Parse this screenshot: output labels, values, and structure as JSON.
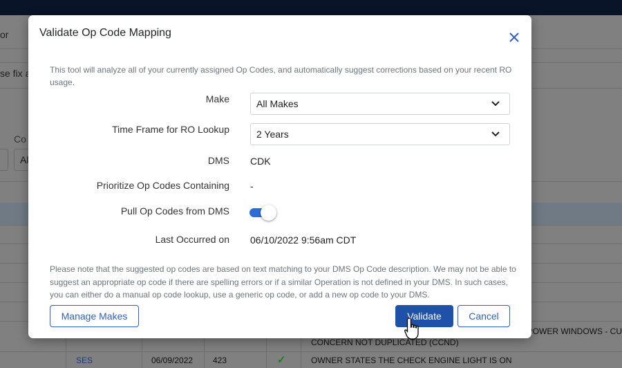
{
  "background": {
    "partial_texts": {
      "dropdown": "or",
      "notice": "se fix a",
      "column_label": "Co",
      "filter_value": "Al"
    },
    "rows": [
      {
        "desc_partial": "G/POWER WINDOWS - CU"
      },
      {
        "desc": "CONCERN NOT DUPLICATED (CCND)"
      },
      {
        "code": "SES",
        "date": "06/09/2022",
        "number": "423",
        "status": "check",
        "desc": "OWNER STATES THE CHECK ENGINE LIGHT IS ON"
      }
    ]
  },
  "modal": {
    "title": "Validate Op Code Mapping",
    "intro": "This tool will analyze all of your currently assigned Op Codes, and automatically suggest corrections based on your recent RO usage.",
    "fields": {
      "make": {
        "label": "Make",
        "value": "All Makes"
      },
      "time_frame": {
        "label": "Time Frame for RO Lookup",
        "value": "2 Years"
      },
      "dms": {
        "label": "DMS",
        "value": "CDK"
      },
      "prioritize": {
        "label": "Prioritize Op Codes Containing",
        "value": "-"
      },
      "pull": {
        "label": "Pull Op Codes from DMS",
        "enabled": true
      },
      "last": {
        "label": "Last Occurred on",
        "value": "06/10/2022 9:56am CDT"
      }
    },
    "note": "Please note that the suggested op codes are based on text matching to your DMS Op Code description. We may not be able to suggest an appropriate op code if there are spelling errors or if a similar Operation is not defined in your DMS. In such cases, you can either do a manual op code lookup, use a generic op code, or add a new op code to your DMS.",
    "buttons": {
      "manage": "Manage Makes",
      "validate": "Validate",
      "cancel": "Cancel"
    }
  },
  "colors": {
    "primary": "#1f51a8",
    "toggle": "#2f6bd6",
    "overlay": "#808080",
    "check": "#1e7e1e"
  }
}
